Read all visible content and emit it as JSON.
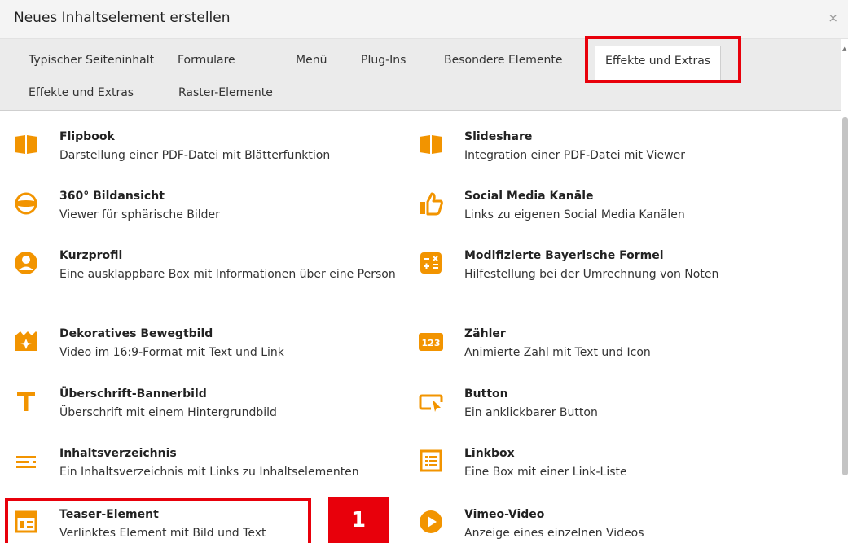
{
  "dialog": {
    "title": "Neues Inhaltselement erstellen",
    "close_symbol": "×"
  },
  "tabs": [
    "Typischer Seiteninhalt",
    "Formulare",
    "Menü",
    "Plug-Ins",
    "Besondere Elemente",
    "Effekte und Extras",
    "Effekte und Extras",
    "Raster-Elemente"
  ],
  "active_tab": "Effekte und Extras",
  "accent_color": "#f29400",
  "highlight_color": "#e8000b",
  "badge": "1",
  "left_items": [
    {
      "icon": "book-icon",
      "name": "Flipbook",
      "desc": "Darstellung einer PDF-Datei mit Blätterfunktion"
    },
    {
      "icon": "panorama-icon",
      "name": "360° Bildansicht",
      "desc": "Viewer für sphärische Bilder"
    },
    {
      "icon": "user-icon",
      "name": "Kurzprofil",
      "desc": "Eine ausklappbare Box mit Informationen über eine Person"
    },
    {
      "icon": "video-sparkle-icon",
      "name": "Dekoratives Bewegtbild",
      "desc": "Video im 16:9-Format mit Text und Link"
    },
    {
      "icon": "text-icon",
      "name": "Überschrift-Bannerbild",
      "desc": "Überschrift mit einem Hintergrundbild"
    },
    {
      "icon": "list-icon",
      "name": "Inhaltsverzeichnis",
      "desc": "Ein Inhaltsverzeichnis mit Links zu Inhaltselementen"
    },
    {
      "icon": "teaser-icon",
      "name": "Teaser-Element",
      "desc": "Verlinktes Element mit Bild und Text"
    }
  ],
  "right_items": [
    {
      "icon": "book-icon",
      "name": "Slideshare",
      "desc": "Integration einer PDF-Datei mit Viewer"
    },
    {
      "icon": "thumbs-up-icon",
      "name": "Social Media Kanäle",
      "desc": "Links zu eigenen Social Media Kanälen"
    },
    {
      "icon": "calculator-icon",
      "name": "Modifizierte Bayerische Formel",
      "desc": "Hilfestellung bei der Umrechnung von Noten"
    },
    {
      "icon": "counter-icon",
      "name": "Zähler",
      "desc": "Animierte Zahl mit Text und Icon",
      "icon_text": "123"
    },
    {
      "icon": "button-icon",
      "name": "Button",
      "desc": "Ein anklickbarer Button"
    },
    {
      "icon": "linkbox-icon",
      "name": "Linkbox",
      "desc": "Eine Box mit einer Link-Liste"
    },
    {
      "icon": "play-icon",
      "name": "Vimeo-Video",
      "desc": "Anzeige eines einzelnen Videos"
    }
  ]
}
